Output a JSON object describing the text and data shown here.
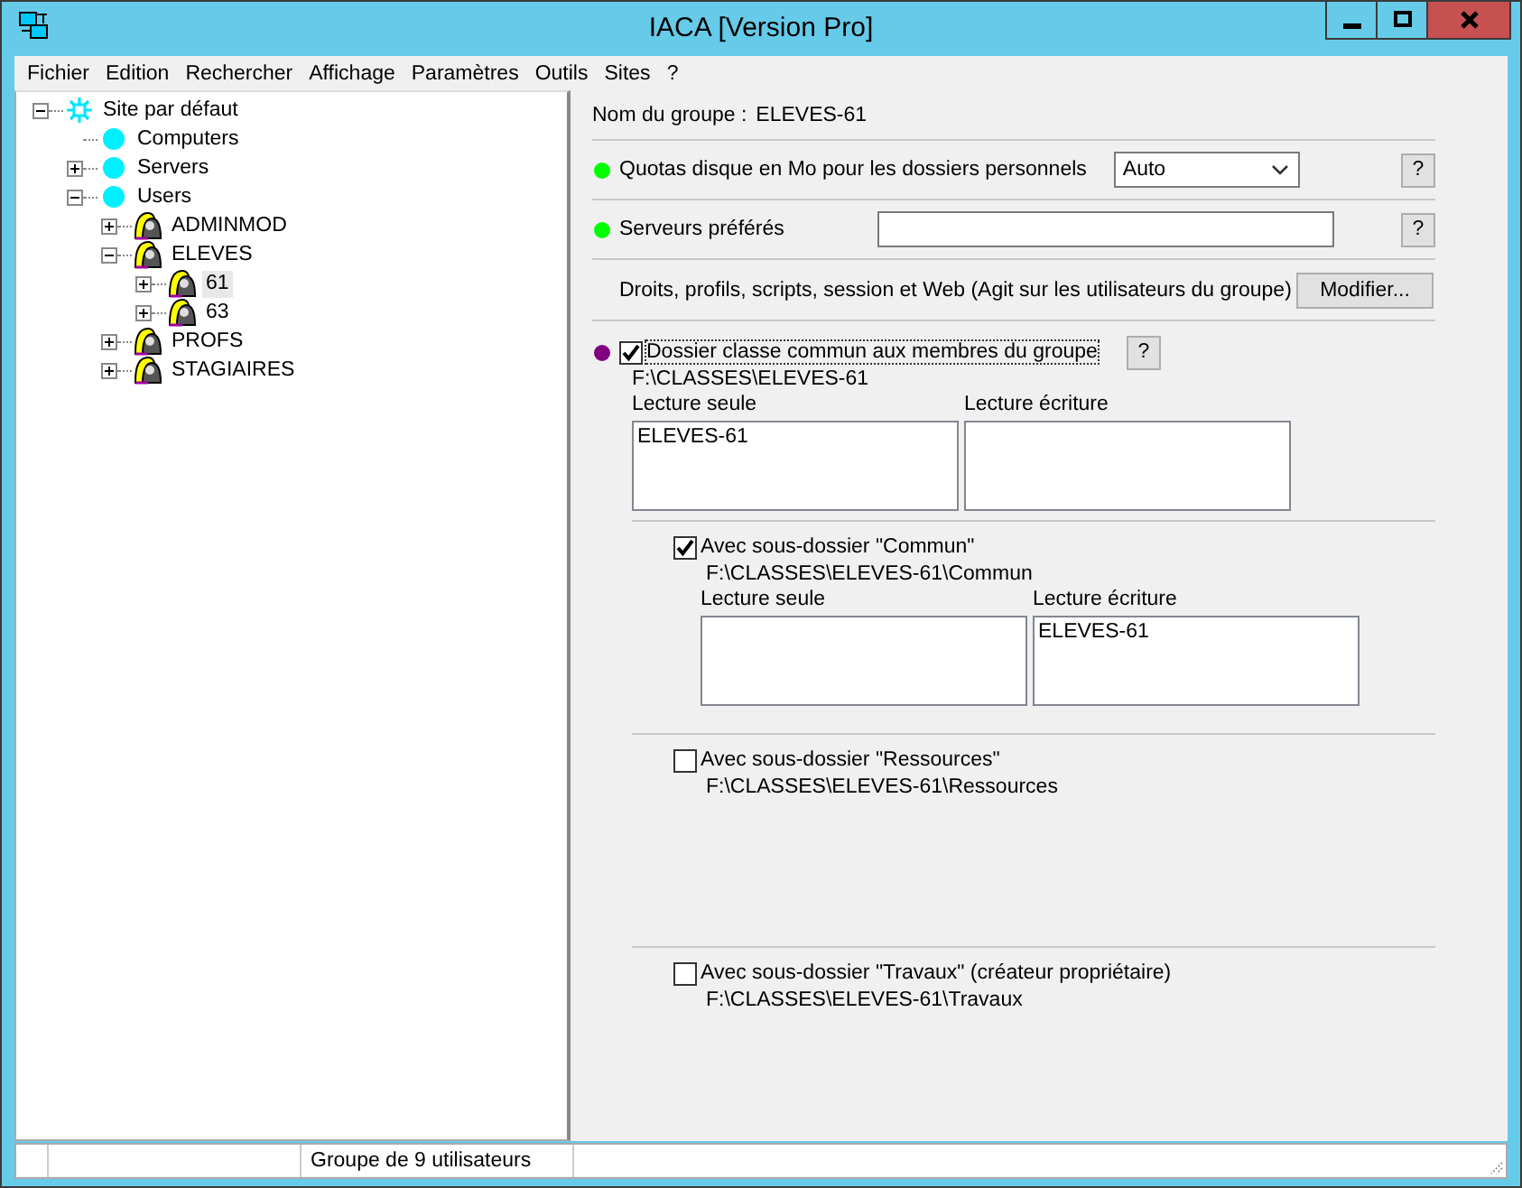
{
  "window": {
    "title": "IACA [Version Pro]"
  },
  "menu": [
    "Fichier",
    "Edition",
    "Rechercher",
    "Affichage",
    "Paramètres",
    "Outils",
    "Sites",
    "?"
  ],
  "tree": [
    {
      "label": "Site par défaut",
      "kind": "site",
      "expanded": true,
      "selected": false,
      "children": [
        {
          "label": "Computers",
          "kind": "node",
          "selected": false
        },
        {
          "label": "Servers",
          "kind": "node",
          "expanded": false,
          "selected": false
        },
        {
          "label": "Users",
          "kind": "node",
          "expanded": true,
          "selected": false,
          "children": [
            {
              "label": "ADMINMOD",
              "kind": "group",
              "expanded": false,
              "selected": false
            },
            {
              "label": "ELEVES",
              "kind": "group",
              "expanded": true,
              "selected": false,
              "children": [
                {
                  "label": "61",
                  "kind": "group",
                  "expanded": false,
                  "selected": true
                },
                {
                  "label": "63",
                  "kind": "group",
                  "expanded": false,
                  "selected": false
                }
              ]
            },
            {
              "label": "PROFS",
              "kind": "group",
              "expanded": false,
              "selected": false
            },
            {
              "label": "STAGIAIRES",
              "kind": "group",
              "expanded": false,
              "selected": false
            }
          ]
        }
      ]
    }
  ],
  "group_name": {
    "label": "Nom du groupe :",
    "value": "ELEVES-61"
  },
  "settings": [
    {
      "kind": "select",
      "color": "#00ff00",
      "label": "Quotas disque en Mo pour les dossiers personnels",
      "value": "Auto",
      "help": "?"
    },
    {
      "kind": "input",
      "color": "#00ff00",
      "label": "Serveurs préférés",
      "help": "?"
    },
    {
      "kind": "button",
      "label": "Droits, profils, scripts, session et Web (Agit sur les utilisateurs du groupe)",
      "button": "Modifier..."
    }
  ],
  "class_folder": {
    "color": "#800080",
    "checked": true,
    "label": "Dossier classe commun aux membres du groupe",
    "help": "?",
    "path": "F:\\CLASSES\\ELEVES-61",
    "read_only": {
      "label": "Lecture seule",
      "items": [
        "ELEVES-61"
      ]
    },
    "read_write": {
      "label": "Lecture écriture"
    }
  },
  "subfolders": [
    {
      "checked": true,
      "label": "Avec sous-dossier \"Commun\"",
      "path": "F:\\CLASSES\\ELEVES-61\\Commun",
      "read_only": {
        "label": "Lecture seule"
      },
      "read_write": {
        "label": "Lecture écriture",
        "items": [
          "ELEVES-61"
        ]
      }
    },
    {
      "checked": false,
      "label": "Avec sous-dossier \"Ressources\"",
      "path": "F:\\CLASSES\\ELEVES-61\\Ressources"
    },
    {
      "checked": false,
      "label": "Avec sous-dossier \"Travaux\" (créateur propriétaire)",
      "path": "F:\\CLASSES\\ELEVES-61\\Travaux"
    }
  ],
  "status_bar": {
    "text": "Groupe de 9 utilisateurs"
  }
}
